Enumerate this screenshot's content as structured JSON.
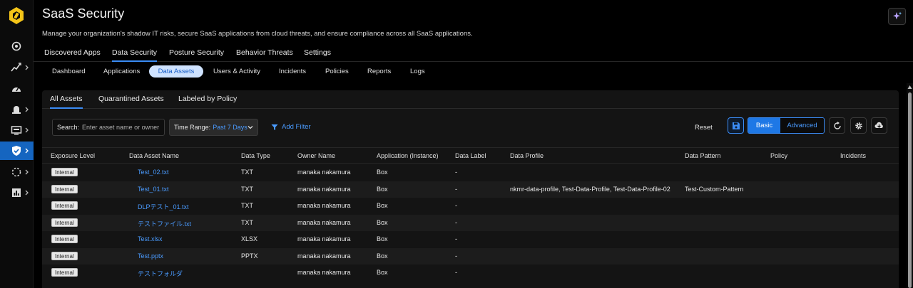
{
  "header": {
    "title": "SaaS Security",
    "description": "Manage your organization's shadow IT risks, secure SaaS applications from cloud threats, and ensure compliance across all SaaS applications."
  },
  "main_tabs": [
    {
      "label": "Discovered Apps",
      "active": false
    },
    {
      "label": "Data Security",
      "active": true
    },
    {
      "label": "Posture Security",
      "active": false
    },
    {
      "label": "Behavior Threats",
      "active": false
    },
    {
      "label": "Settings",
      "active": false
    }
  ],
  "sub_tabs": [
    {
      "label": "Dashboard",
      "active": false
    },
    {
      "label": "Applications",
      "active": false
    },
    {
      "label": "Data Assets",
      "active": true
    },
    {
      "label": "Users & Activity",
      "active": false
    },
    {
      "label": "Incidents",
      "active": false
    },
    {
      "label": "Policies",
      "active": false
    },
    {
      "label": "Reports",
      "active": false
    },
    {
      "label": "Logs",
      "active": false
    }
  ],
  "asset_tabs": [
    {
      "label": "All Assets",
      "active": true
    },
    {
      "label": "Quarantined Assets",
      "active": false
    },
    {
      "label": "Labeled by Policy",
      "active": false
    }
  ],
  "toolbar": {
    "search_label": "Search:",
    "search_placeholder": "Enter asset name or owner",
    "time_range_label": "Time Range:",
    "time_range_value": "Past 7 Days",
    "add_filter": "Add Filter",
    "reset": "Reset",
    "view_basic": "Basic",
    "view_advanced": "Advanced"
  },
  "table": {
    "columns": [
      "Exposure Level",
      "Data Asset Name",
      "Data Type",
      "Owner Name",
      "Application (Instance)",
      "Data Label",
      "Data Profile",
      "Data Pattern",
      "Policy",
      "Incidents"
    ],
    "rows": [
      {
        "exposure": "Internal",
        "name": "Test_02.txt",
        "type": "TXT",
        "owner": "manaka nakamura",
        "app": "Box",
        "label": "-",
        "profile": "",
        "pattern": "",
        "policy": "",
        "incidents": ""
      },
      {
        "exposure": "Internal",
        "name": "Test_01.txt",
        "type": "TXT",
        "owner": "manaka nakamura",
        "app": "Box",
        "label": "-",
        "profile": "nkmr-data-profile, Test-Data-Profile, Test-Data-Profile-02",
        "pattern": "Test-Custom-Pattern",
        "policy": "",
        "incidents": ""
      },
      {
        "exposure": "Internal",
        "name": "DLPテスト_01.txt",
        "type": "TXT",
        "owner": "manaka nakamura",
        "app": "Box",
        "label": "-",
        "profile": "",
        "pattern": "",
        "policy": "",
        "incidents": ""
      },
      {
        "exposure": "Internal",
        "name": "テストファイル.txt",
        "type": "TXT",
        "owner": "manaka nakamura",
        "app": "Box",
        "label": "-",
        "profile": "",
        "pattern": "",
        "policy": "",
        "incidents": ""
      },
      {
        "exposure": "Internal",
        "name": "Test.xlsx",
        "type": "XLSX",
        "owner": "manaka nakamura",
        "app": "Box",
        "label": "-",
        "profile": "",
        "pattern": "",
        "policy": "",
        "incidents": ""
      },
      {
        "exposure": "Internal",
        "name": "Test.pptx",
        "type": "PPTX",
        "owner": "manaka nakamura",
        "app": "Box",
        "label": "-",
        "profile": "",
        "pattern": "",
        "policy": "",
        "incidents": ""
      },
      {
        "exposure": "Internal",
        "name": "テストフォルダ",
        "type": "",
        "owner": "manaka nakamura",
        "app": "Box",
        "label": "-",
        "profile": "",
        "pattern": "",
        "policy": "",
        "incidents": ""
      }
    ]
  },
  "colors": {
    "accent": "#3b8cf5",
    "link": "#4a9bff",
    "logo": "#f5c518",
    "nav_active": "#1565c0"
  },
  "icons": {
    "rail": [
      "dashboard-icon",
      "activity-icon",
      "gauge-icon",
      "alarm-icon",
      "device-icon",
      "shield-check-icon",
      "network-icon",
      "report-icon"
    ],
    "toolbar": [
      "save-icon",
      "refresh-icon",
      "gear-icon",
      "cloud-download-icon",
      "sparkle-icon",
      "filter-icon"
    ]
  }
}
